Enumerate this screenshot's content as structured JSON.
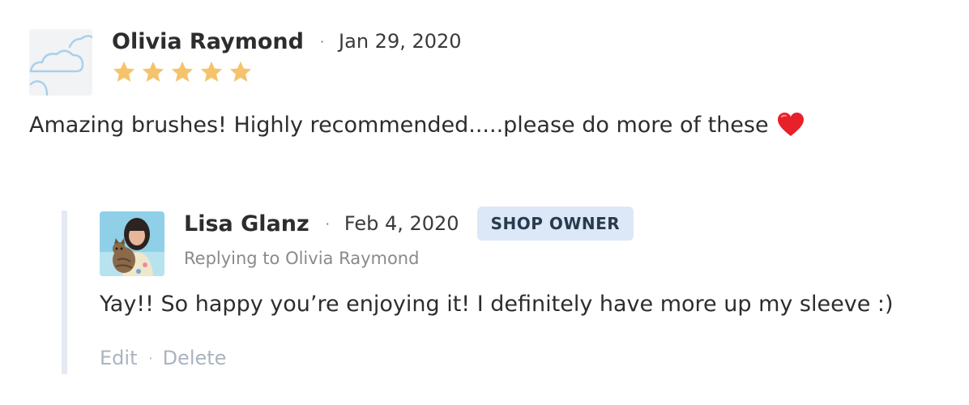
{
  "review": {
    "author": "Olivia Raymond",
    "separator": "·",
    "date": "Jan 29, 2020",
    "rating": 5,
    "rating_max": 5,
    "text": "Amazing brushes! Highly recommended.....please do more of these",
    "avatar_icon": "cloud-icon",
    "emoji_icon": "heart-icon"
  },
  "reply": {
    "author": "Lisa Glanz",
    "separator": "·",
    "date": "Feb 4, 2020",
    "badge": "SHOP OWNER",
    "replying_to": "Replying to Olivia Raymond",
    "text": "Yay!! So happy you’re enjoying it! I definitely have more up my sleeve :)",
    "actions": {
      "edit_label": "Edit",
      "separator": "·",
      "delete_label": "Delete"
    }
  },
  "colors": {
    "star": "#f5c36b",
    "badge_bg": "#dce8f7",
    "reply_bar": "#e4e9f2",
    "action_text": "#aab4c0",
    "heart": "#e8202a"
  }
}
